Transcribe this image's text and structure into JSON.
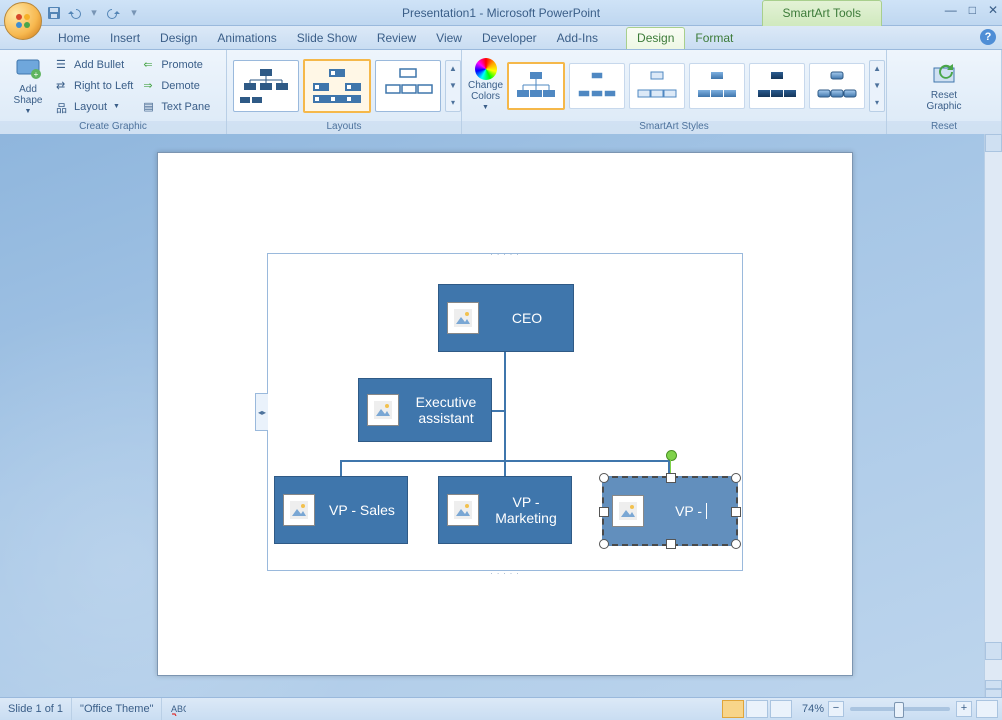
{
  "title": "Presentation1 - Microsoft PowerPoint",
  "context_title": "SmartArt Tools",
  "qat": {
    "save": "save-icon",
    "undo": "undo-icon",
    "redo": "redo-icon",
    "custom": "customize-qat"
  },
  "tabs": [
    "Home",
    "Insert",
    "Design",
    "Animations",
    "Slide Show",
    "Review",
    "View",
    "Developer",
    "Add-Ins"
  ],
  "context_tabs": [
    "Design",
    "Format"
  ],
  "active_context_tab": "Design",
  "ribbon": {
    "create_graphic": {
      "label": "Create Graphic",
      "add_shape": "Add\nShape",
      "items": [
        "Add Bullet",
        "Right to Left",
        "Layout",
        "Promote",
        "Demote",
        "Text Pane"
      ]
    },
    "layouts": {
      "label": "Layouts"
    },
    "styles": {
      "label": "SmartArt Styles",
      "change_colors": "Change\nColors"
    },
    "reset": {
      "label": "Reset",
      "btn": "Reset\nGraphic"
    }
  },
  "orgchart": {
    "ceo": "CEO",
    "assistant": "Executive\nassistant",
    "vp1": "VP - Sales",
    "vp2": "VP -\nMarketing",
    "vp3": "VP -"
  },
  "status": {
    "slide": "Slide 1 of 1",
    "theme": "\"Office Theme\"",
    "zoom": "74%"
  }
}
